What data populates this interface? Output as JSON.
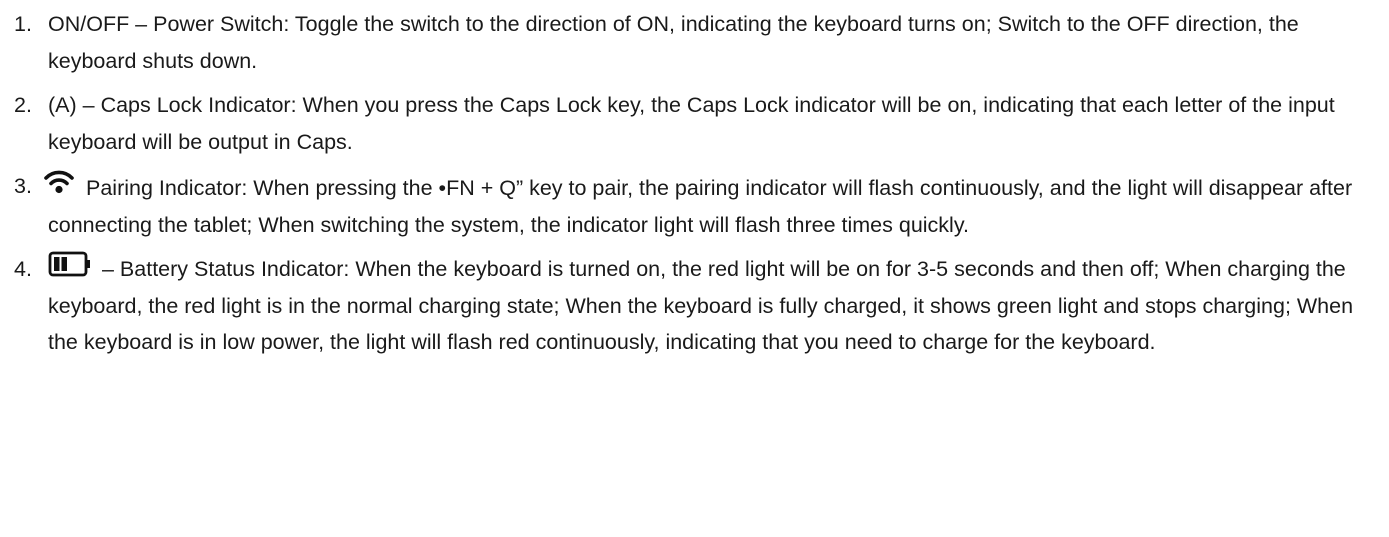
{
  "items": [
    {
      "number": "1.",
      "text": "ON/OFF – Power Switch: Toggle the switch to the direction of ON, indicating the keyboard turns on; Switch to the OFF direction, the keyboard shuts down."
    },
    {
      "number": "2.",
      "text": "(A) – Caps Lock Indicator: When you press the Caps Lock key, the Caps Lock indicator will be on, indicating that each letter of the input keyboard will be output in Caps."
    },
    {
      "number": "3.",
      "icon": "wifi-icon",
      "text": "Pairing Indicator: When pressing the •FN + Q” key to pair, the pairing indicator will flash continuously, and the light will disappear after connecting the tablet; When switching the system, the indicator light will flash three times quickly."
    },
    {
      "number": "4.",
      "icon": "battery-icon",
      "text": "– Battery Status Indicator: When the keyboard is turned on, the red light will be on for 3-5 seconds and then off; When charging the keyboard, the red light is in the normal charging state; When the keyboard is fully charged, it shows green light and stops charging; When the keyboard is in low power, the light will flash red continuously, indicating that you need to charge for the keyboard."
    }
  ],
  "colors": {
    "text": "#1a1a1a",
    "icon": "#111111",
    "background": "#ffffff"
  }
}
